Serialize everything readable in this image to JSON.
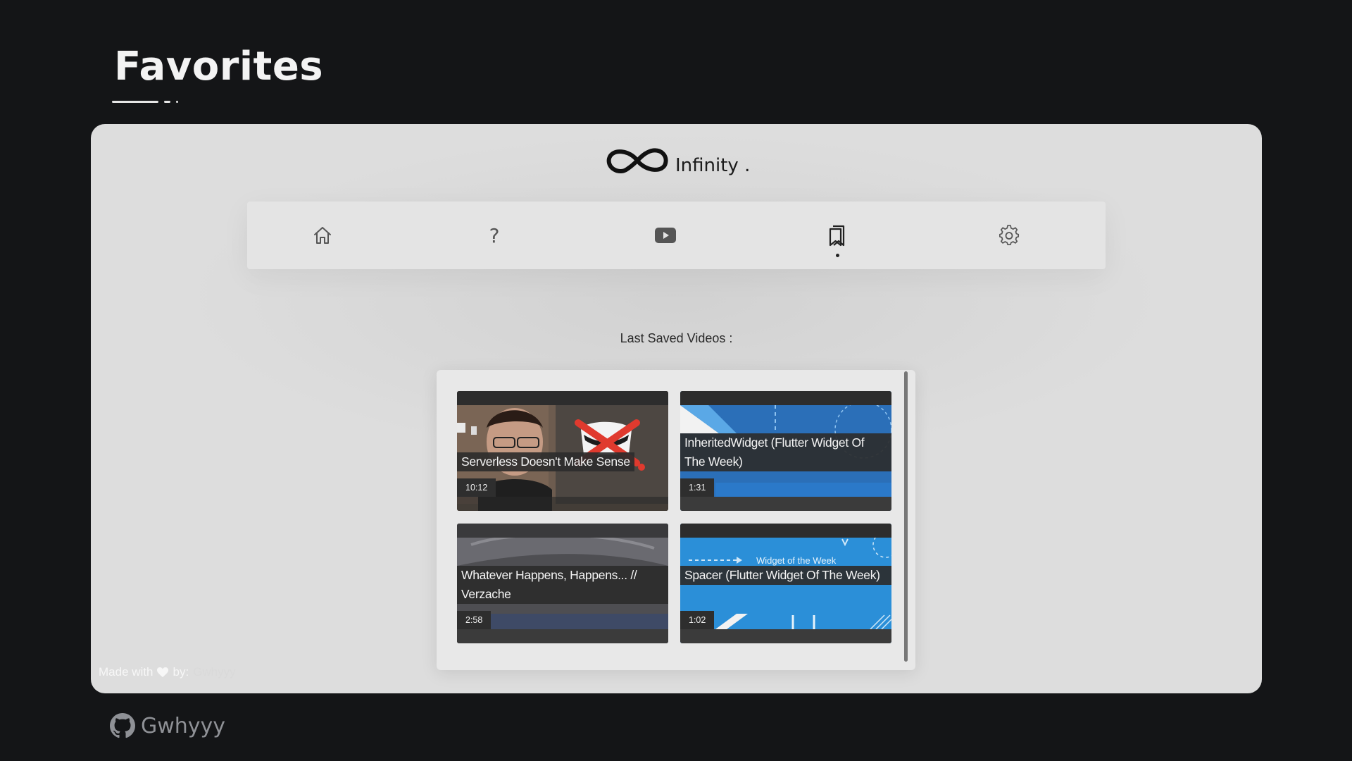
{
  "page": {
    "heading": "Favorites"
  },
  "app": {
    "name": "Infinity ."
  },
  "nav": {
    "items": [
      {
        "name": "home",
        "icon": "home-icon"
      },
      {
        "name": "help",
        "icon": "question-icon",
        "label": "?"
      },
      {
        "name": "videos",
        "icon": "play-icon"
      },
      {
        "name": "favorites",
        "icon": "bookmark-icon",
        "active": true
      },
      {
        "name": "settings",
        "icon": "gear-icon"
      }
    ]
  },
  "saved": {
    "label": "Last Saved Videos :",
    "videos": [
      {
        "title": "Serverless Doesn't Make Sense",
        "duration": "10:12"
      },
      {
        "title": "InheritedWidget (Flutter Widget Of The Week)",
        "duration": "1:31"
      },
      {
        "title": "Whatever Happens, Happens... // Verzache",
        "duration": "2:58"
      },
      {
        "title": "Spacer (Flutter Widget Of The Week)",
        "duration": "1:02",
        "thumb_text": "Widget of the Week"
      }
    ]
  },
  "footer": {
    "made_with": "Made with",
    "by": "by:",
    "author": "Gwhyyy"
  },
  "github": {
    "username": "Gwhyyy"
  },
  "colors": {
    "background": "#141517",
    "panel": "#dddddd",
    "navbar": "#e4e4e4",
    "flutter_blue": "#2b8fd8"
  }
}
